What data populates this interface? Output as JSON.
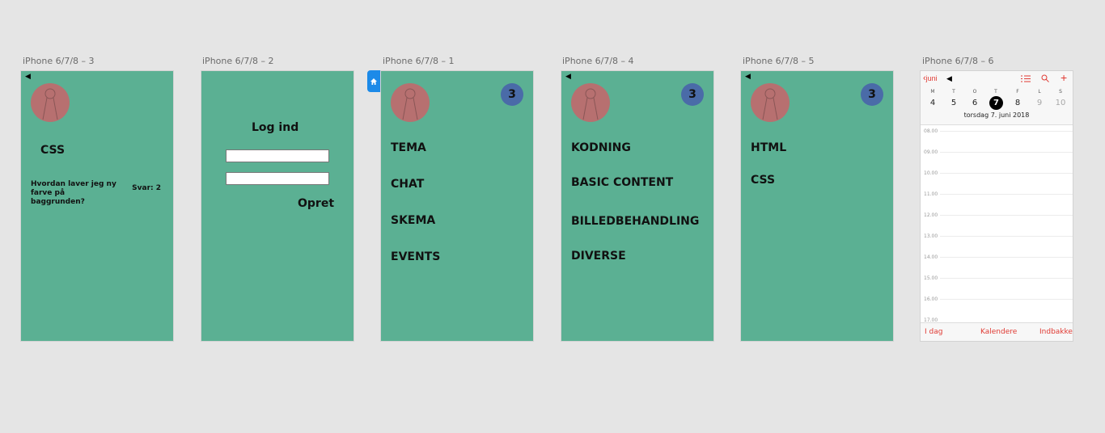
{
  "artboards": [
    {
      "label": "iPhone 6/7/8 – 3"
    },
    {
      "label": "iPhone 6/7/8 – 2"
    },
    {
      "label": "iPhone 6/7/8 – 1"
    },
    {
      "label": "iPhone 6/7/8 – 4"
    },
    {
      "label": "iPhone 6/7/8 – 5"
    },
    {
      "label": "iPhone 6/7/8 – 6"
    }
  ],
  "screen3": {
    "title": "CSS",
    "question": "Hvordan laver jeg ny farve på baggrunden?",
    "answers": "Svar: 2"
  },
  "screen2": {
    "title": "Log ind",
    "create": "Opret"
  },
  "screen1": {
    "badge": "3",
    "menu": [
      "TEMA",
      "CHAT",
      "SKEMA",
      "EVENTS"
    ]
  },
  "screen4": {
    "badge": "3",
    "menu": [
      "KODNING",
      "BASIC CONTENT",
      "BILLEDBEHANDLING",
      "DIVERSE"
    ]
  },
  "screen5": {
    "badge": "3",
    "menu": [
      "HTML",
      "CSS"
    ]
  },
  "calendar": {
    "back_label": "juni",
    "weekdays": [
      "M",
      "T",
      "O",
      "T",
      "F",
      "L",
      "S"
    ],
    "days": [
      "4",
      "5",
      "6",
      "7",
      "8",
      "9",
      "10"
    ],
    "selected_date": "torsdag  7. juni 2018",
    "hours": [
      "08.00",
      "09.00",
      "10.00",
      "11.00",
      "12.00",
      "13.00",
      "14.00",
      "15.00",
      "16.00",
      "17.00"
    ],
    "tabs": [
      "I dag",
      "Kalendere",
      "Indbakke"
    ],
    "accent": "#e03a33"
  },
  "colors": {
    "board": "#5bb093",
    "avatar": "#b77070",
    "badge": "#4a6ba8",
    "canvas": "#e5e5e5"
  }
}
